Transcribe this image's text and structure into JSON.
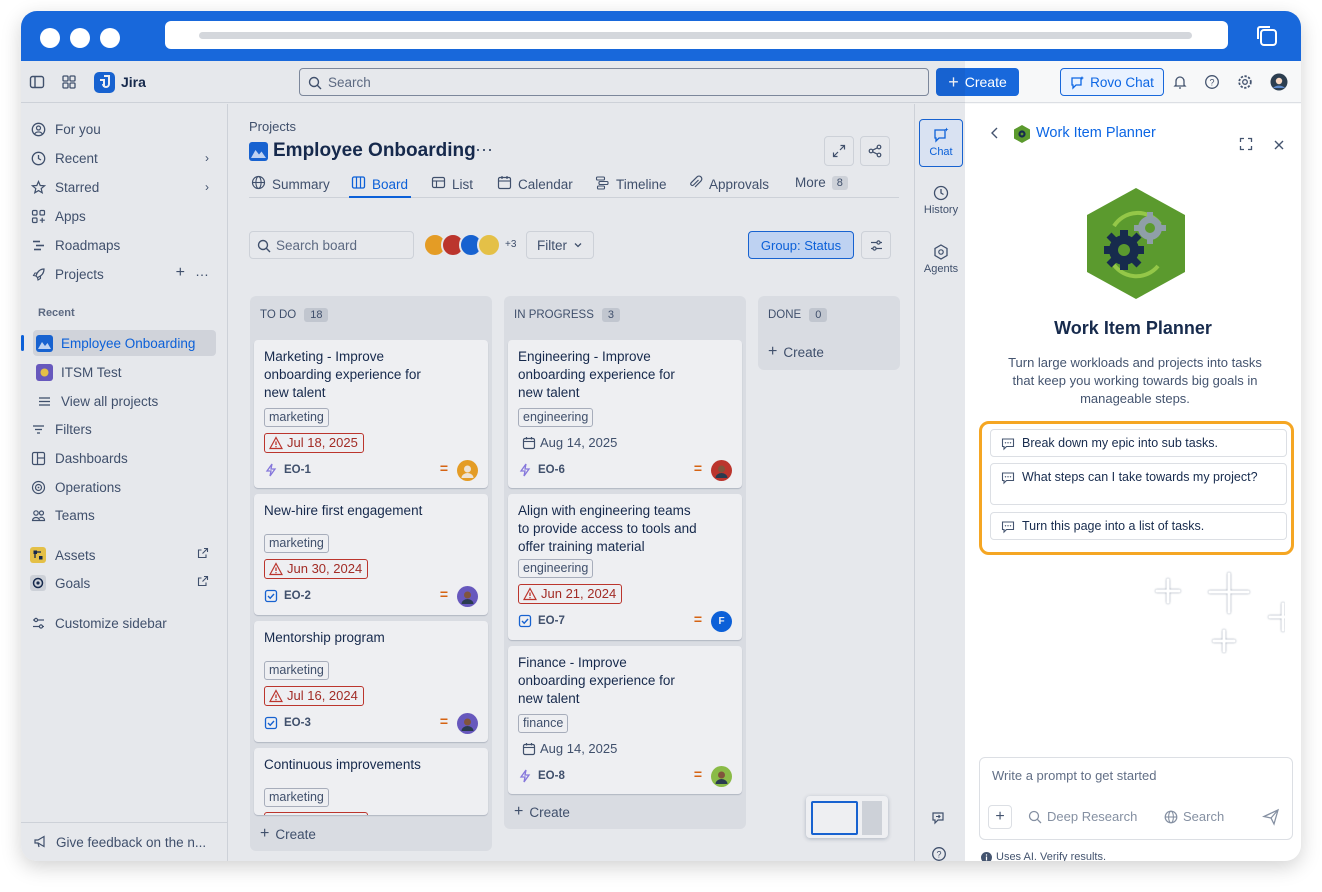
{
  "app": {
    "name": "Jira"
  },
  "topnav": {
    "search_placeholder": "Search",
    "create_label": "Create",
    "rovo_label": "Rovo Chat"
  },
  "sidebar": {
    "items": [
      {
        "label": "For you",
        "icon": "person-circle-icon"
      },
      {
        "label": "Recent",
        "icon": "clock-icon"
      },
      {
        "label": "Starred",
        "icon": "star-icon"
      },
      {
        "label": "Apps",
        "icon": "apps-icon"
      },
      {
        "label": "Roadmaps",
        "icon": "roadmap-icon"
      },
      {
        "label": "Projects",
        "icon": "rocket-icon"
      }
    ],
    "recent_heading": "Recent",
    "recent_projects": [
      {
        "label": "Employee Onboarding"
      },
      {
        "label": "ITSM Test"
      }
    ],
    "view_all": "View all projects",
    "more_items": [
      {
        "label": "Filters",
        "icon": "filter-icon"
      },
      {
        "label": "Dashboards",
        "icon": "dashboard-icon"
      },
      {
        "label": "Operations",
        "icon": "operations-icon"
      },
      {
        "label": "Teams",
        "icon": "teams-icon"
      },
      {
        "label": "Assets",
        "icon": "assets-icon"
      },
      {
        "label": "Goals",
        "icon": "goals-icon"
      },
      {
        "label": "Customize sidebar",
        "icon": "customize-icon"
      }
    ],
    "feedback": "Give feedback on the n..."
  },
  "project": {
    "breadcrumb": "Projects",
    "title": "Employee Onboarding",
    "tabs": [
      {
        "label": "Summary"
      },
      {
        "label": "Board"
      },
      {
        "label": "List"
      },
      {
        "label": "Calendar"
      },
      {
        "label": "Timeline"
      },
      {
        "label": "Approvals"
      },
      {
        "label": "More",
        "count": "8"
      }
    ]
  },
  "toolbar": {
    "search_placeholder": "Search board",
    "avatars_more": "+3",
    "filter_label": "Filter",
    "group_label": "Group: Status"
  },
  "board": {
    "columns": [
      {
        "name": "TO DO",
        "count": "18",
        "cards": [
          {
            "title": "Marketing - Improve onboarding experience for new talent",
            "label": "marketing",
            "date": "Jul 18, 2025",
            "key": "EO-1"
          },
          {
            "title": "New-hire first engagement",
            "label": "marketing",
            "date": "Jun 30, 2024",
            "key": "EO-2"
          },
          {
            "title": "Mentorship program",
            "label": "marketing",
            "date": "Jul 16, 2024",
            "key": "EO-3"
          },
          {
            "title": "Continuous improvements",
            "label": "marketing"
          }
        ],
        "create": "Create"
      },
      {
        "name": "IN PROGRESS",
        "count": "3",
        "cards": [
          {
            "title": "Engineering - Improve onboarding experience for new talent",
            "label": "engineering",
            "date": "Aug 14, 2025",
            "key": "EO-6"
          },
          {
            "title": "Align with engineering teams to provide access to tools and offer training material",
            "label": "engineering",
            "date": "Jun 21, 2024",
            "key": "EO-7",
            "assignee": "F"
          },
          {
            "title": "Finance - Improve onboarding experience for new talent",
            "label": "finance",
            "date": "Aug 14, 2025",
            "key": "EO-8"
          }
        ],
        "create": "Create"
      },
      {
        "name": "DONE",
        "count": "0",
        "cards": [],
        "create": "Create"
      }
    ]
  },
  "rail": {
    "items": [
      {
        "label": "Chat"
      },
      {
        "label": "History"
      },
      {
        "label": "Agents"
      }
    ]
  },
  "panel": {
    "title": "Work Item Planner",
    "heading": "Work Item Planner",
    "description": "Turn large workloads and projects into tasks that keep you working towards big goals in manageable steps.",
    "suggestions": [
      {
        "text": "Break down my epic into sub tasks."
      },
      {
        "text": "What steps can I take towards my project?"
      },
      {
        "text": "Turn this page into a list of tasks."
      }
    ],
    "prompt_placeholder": "Write a prompt to get started",
    "options": [
      {
        "label": "Deep Research"
      },
      {
        "label": "Search"
      }
    ],
    "ai_note": "Uses AI. Verify results."
  },
  "colors": {
    "brand": "#1868db",
    "highlight": "#f5a623",
    "overdue": "#c9372c",
    "planner_green": "#5b9a2e"
  }
}
